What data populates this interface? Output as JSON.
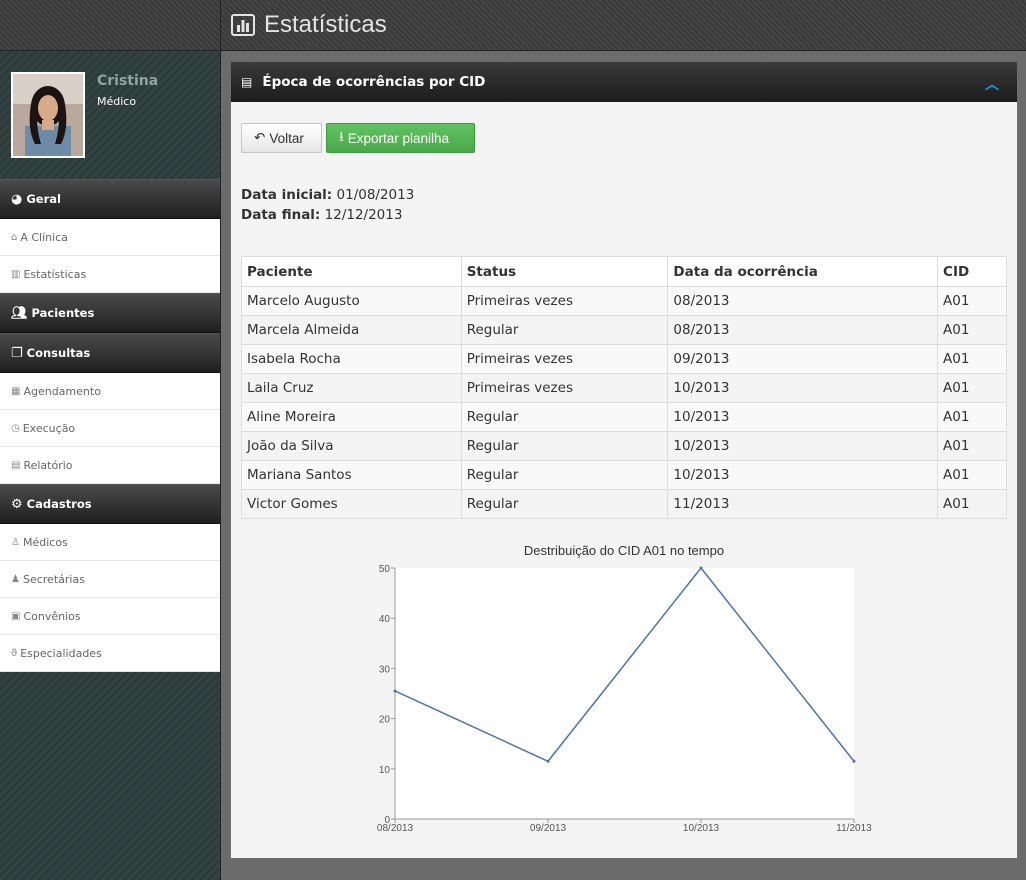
{
  "app": {
    "page_title": "Estatísticas"
  },
  "user": {
    "name": "Cristina",
    "role": "Médico"
  },
  "sidebar": {
    "sections": [
      {
        "title": "Geral",
        "icon": "dashboard-icon",
        "items": [
          {
            "label": "A Clínica",
            "icon": "home-icon"
          },
          {
            "label": "Estatísticas",
            "icon": "bar-chart-icon"
          }
        ]
      },
      {
        "title": "Pacientes",
        "icon": "users-icon",
        "items": []
      },
      {
        "title": "Consultas",
        "icon": "copy-icon",
        "items": [
          {
            "label": "Agendamento",
            "icon": "calendar-icon"
          },
          {
            "label": "Execução",
            "icon": "clock-icon"
          },
          {
            "label": "Relatório",
            "icon": "file-icon"
          }
        ]
      },
      {
        "title": "Cadastros",
        "icon": "gear-icon",
        "items": [
          {
            "label": "Médicos",
            "icon": "user-md-icon"
          },
          {
            "label": "Secretárias",
            "icon": "user-icon"
          },
          {
            "label": "Convênios",
            "icon": "briefcase-icon"
          },
          {
            "label": "Especialidades",
            "icon": "stethoscope-icon"
          }
        ]
      }
    ]
  },
  "panel": {
    "title": "Época de ocorrências por CID",
    "back_label": "Voltar",
    "export_label": "Exportar planilha",
    "start_date_label": "Data inicial:",
    "start_date": "01/08/2013",
    "end_date_label": "Data final:",
    "end_date": "12/12/2013"
  },
  "table": {
    "headers": [
      "Paciente",
      "Status",
      "Data da ocorrência",
      "CID"
    ],
    "rows": [
      [
        "Marcelo Augusto",
        "Primeiras vezes",
        "08/2013",
        "A01"
      ],
      [
        "Marcela Almeida",
        "Regular",
        "08/2013",
        "A01"
      ],
      [
        "Isabela Rocha",
        "Primeiras vezes",
        "09/2013",
        "A01"
      ],
      [
        "Laila Cruz",
        "Primeiras vezes",
        "10/2013",
        "A01"
      ],
      [
        "Aline Moreira",
        "Regular",
        "10/2013",
        "A01"
      ],
      [
        "João da Silva",
        "Regular",
        "10/2013",
        "A01"
      ],
      [
        "Mariana Santos",
        "Regular",
        "10/2013",
        "A01"
      ],
      [
        "Victor Gomes",
        "Regular",
        "11/2013",
        "A01"
      ]
    ]
  },
  "chart_data": {
    "type": "line",
    "title": "Destribuição do CID A01 no tempo",
    "categories": [
      "08/2013",
      "09/2013",
      "10/2013",
      "11/2013"
    ],
    "values": [
      25.5,
      11.5,
      50,
      11.5
    ],
    "ylim": [
      0,
      50
    ],
    "yticks": [
      0,
      10,
      20,
      30,
      40,
      50
    ],
    "xlabel": "",
    "ylabel": "",
    "line_color": "#4f74a8",
    "grid": false
  }
}
